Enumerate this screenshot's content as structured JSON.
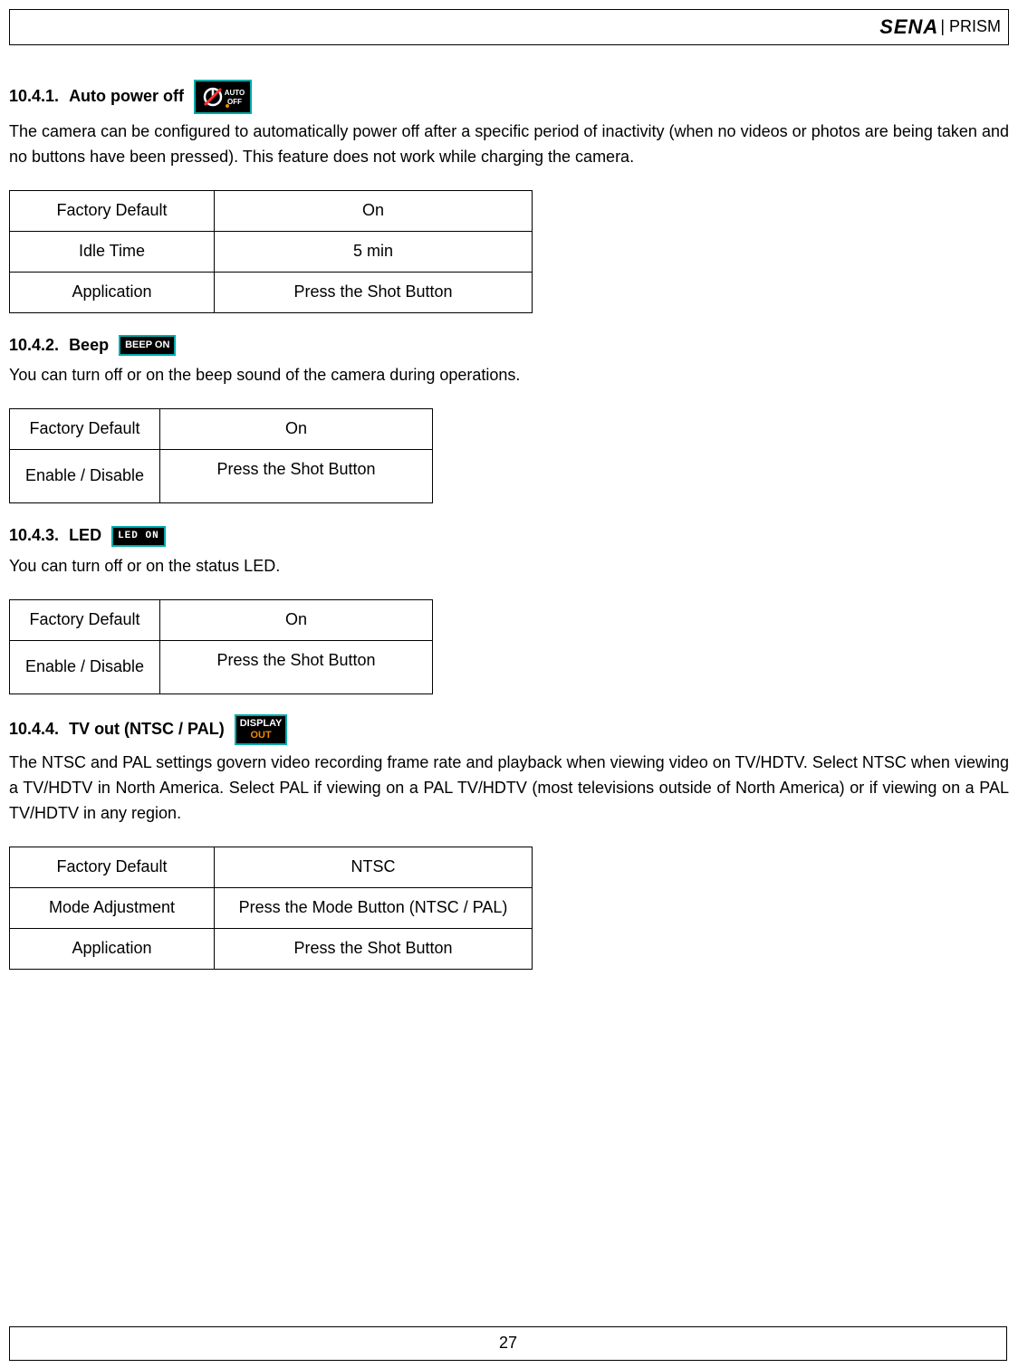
{
  "header": {
    "logo_text": "SENA",
    "product": "| PRISM"
  },
  "sections": {
    "auto_power_off": {
      "number": "10.4.1.",
      "title": "Auto power off",
      "icon_label_top": "AUTO",
      "icon_label_bottom": "OFF",
      "body": "The camera can be configured to automatically power off after a specific period of inactivity (when no videos or photos are being taken and no buttons have been pressed). This feature does not work while charging the camera.",
      "table": [
        {
          "label": "Factory Default",
          "value": "On"
        },
        {
          "label": "Idle Time",
          "value": "5 min"
        },
        {
          "label": "Application",
          "value": "Press the Shot Button"
        }
      ]
    },
    "beep": {
      "number": "10.4.2.",
      "title": "Beep",
      "icon_label": "BEEP ON",
      "body": "You can turn off or on the beep sound of the camera during operations.",
      "table": [
        {
          "label": "Factory Default",
          "value": "On"
        },
        {
          "label": "Enable / Disable",
          "value": "Press the Shot Button"
        }
      ]
    },
    "led": {
      "number": "10.4.3.",
      "title": "LED",
      "icon_label": "LED ON",
      "body": "You can turn off or on the status LED.",
      "table": [
        {
          "label": "Factory Default",
          "value": "On"
        },
        {
          "label": "Enable / Disable",
          "value": "Press the Shot Button"
        }
      ]
    },
    "tv_out": {
      "number": "10.4.4.",
      "title": "TV out (NTSC / PAL)",
      "icon_label_top": "DISPLAY",
      "icon_label_bottom": "OUT",
      "body": "The NTSC and PAL settings govern video recording frame rate and playback when viewing video on TV/HDTV. Select NTSC when viewing a TV/HDTV in North America. Select PAL if viewing on a PAL TV/HDTV (most televisions outside of North America) or if viewing on a PAL TV/HDTV in any region.",
      "table": [
        {
          "label": "Factory Default",
          "value": "NTSC"
        },
        {
          "label": "Mode Adjustment",
          "value": "Press the Mode Button (NTSC / PAL)"
        },
        {
          "label": "Application",
          "value": "Press the Shot Button"
        }
      ]
    }
  },
  "footer": {
    "page_number": "27"
  }
}
